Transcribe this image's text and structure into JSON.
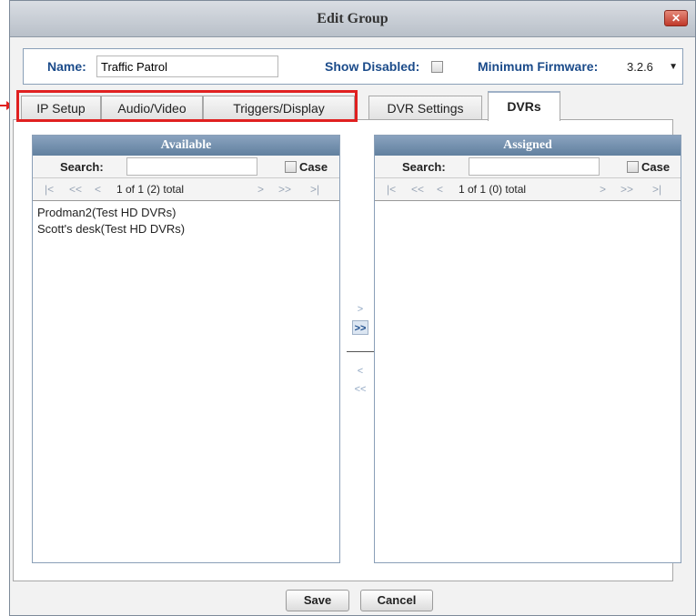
{
  "dialog": {
    "title": "Edit Group",
    "close_icon": "close-icon"
  },
  "form": {
    "name_label": "Name:",
    "name_value": "Traffic Patrol",
    "show_disabled_label": "Show Disabled:",
    "show_disabled_checked": false,
    "min_firmware_label": "Minimum Firmware:",
    "min_firmware_value": "3.2.6"
  },
  "tabs": [
    {
      "label": "IP Setup",
      "active": false
    },
    {
      "label": "Audio/Video",
      "active": false
    },
    {
      "label": "Triggers/Display",
      "active": false
    },
    {
      "label": "DVR Settings",
      "active": false
    },
    {
      "label": "DVRs",
      "active": true
    }
  ],
  "annotation": {
    "highlight_color": "#e02020"
  },
  "available": {
    "header": "Available",
    "search_label": "Search:",
    "search_value": "",
    "case_label": "Case",
    "pager_text": "1 of 1 (2) total",
    "items": [
      "Prodman2(Test HD DVRs)",
      "Scott's desk(Test HD DVRs)"
    ]
  },
  "assigned": {
    "header": "Assigned",
    "search_label": "Search:",
    "search_value": "",
    "case_label": "Case",
    "pager_text": "1 of 1 (0) total",
    "items": []
  },
  "pager_icons": {
    "first": "|<",
    "prev_page": "<<",
    "prev": "<",
    "next": ">",
    "next_page": ">>",
    "last": ">|"
  },
  "transfer": {
    "add_one": ">",
    "add_all": ">>",
    "remove_one": "<",
    "remove_all": "<<"
  },
  "footer": {
    "save_label": "Save",
    "cancel_label": "Cancel"
  }
}
